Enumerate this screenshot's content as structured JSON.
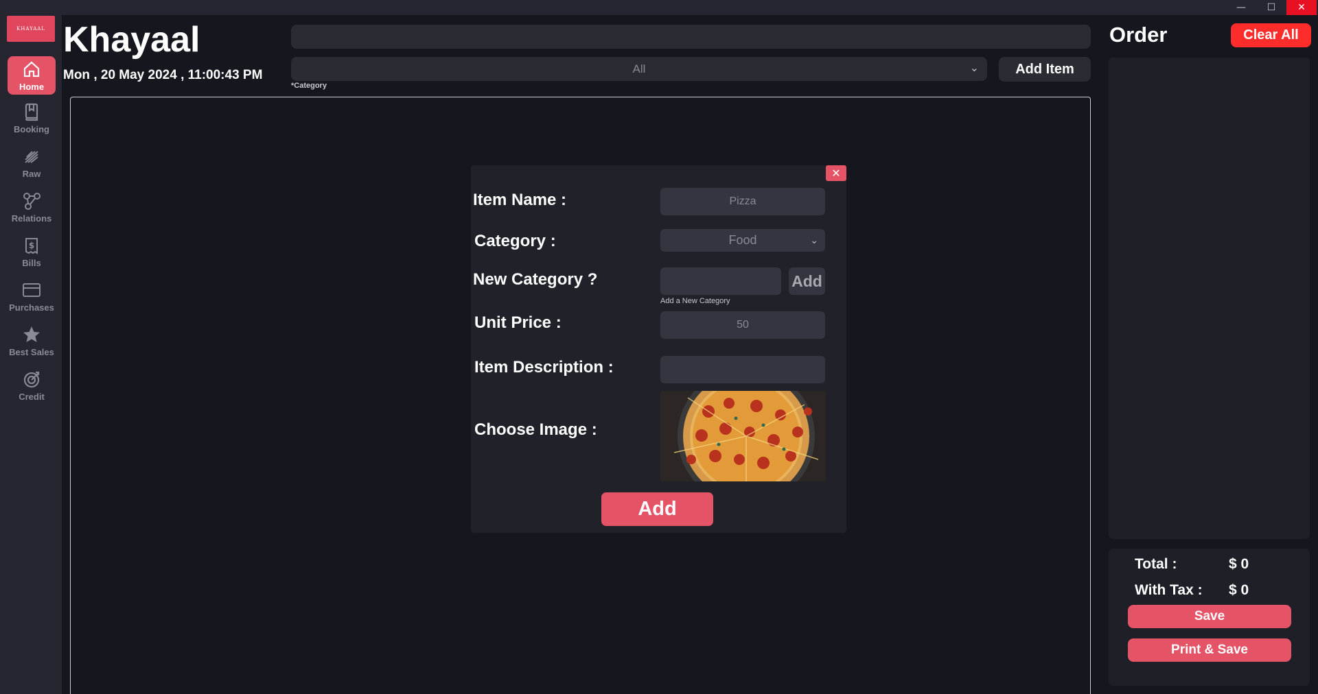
{
  "window": {
    "minimize_glyph": "—",
    "maximize_glyph": "☐",
    "close_glyph": "✕"
  },
  "sidebar": {
    "logo_text": "KHAYAAL",
    "items": [
      {
        "label": "Home",
        "icon": "home-icon",
        "active": true
      },
      {
        "label": "Booking",
        "icon": "book-icon"
      },
      {
        "label": "Raw",
        "icon": "raw-icon"
      },
      {
        "label": "Relations",
        "icon": "relations-icon"
      },
      {
        "label": "Bills",
        "icon": "bills-icon"
      },
      {
        "label": "Purchases",
        "icon": "purchases-icon"
      },
      {
        "label": "Best Sales",
        "icon": "star-icon"
      },
      {
        "label": "Credit",
        "icon": "target-icon"
      }
    ]
  },
  "header": {
    "brand": "Khayaal",
    "datetime": "Mon , 20 May 2024 , 11:00:43 PM",
    "search_value": "",
    "category_selected": "All",
    "category_caption": "*Category",
    "add_item_label": "Add Item"
  },
  "order": {
    "title": "Order",
    "clear_all_label": "Clear All",
    "total_label": "Total :",
    "total_value": "$  0",
    "with_tax_label": "With Tax :",
    "with_tax_value": "$  0",
    "save_label": "Save",
    "print_save_label": "Print & Save"
  },
  "modal": {
    "close_glyph": "✕",
    "item_name_label": "Item Name :",
    "item_name_placeholder": "Pizza",
    "category_label": "Category :",
    "category_selected": "Food",
    "new_category_label": "New Category ?",
    "new_category_add_label": "Add",
    "new_category_caption": "Add a New Category",
    "unit_price_label": "Unit Price :",
    "unit_price_placeholder": "50",
    "item_description_label": "Item Description :",
    "choose_image_label": "Choose Image :",
    "add_label": "Add"
  },
  "colors": {
    "accent": "#e55367",
    "danger": "#ff2c2c",
    "background": "#16171e",
    "panel": "#262630"
  }
}
